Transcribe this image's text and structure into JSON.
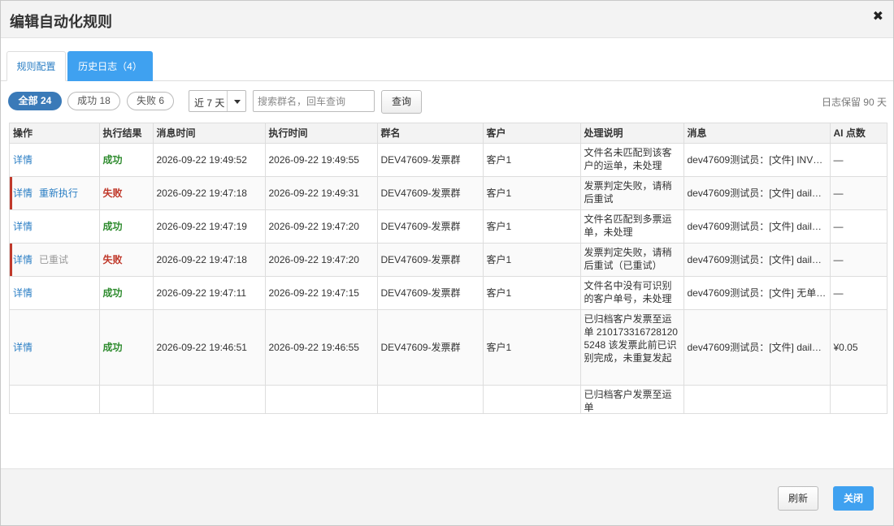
{
  "dialog": {
    "title": "编辑自动化规则",
    "close_glyph": "✖"
  },
  "tabs": [
    {
      "label": "规则配置",
      "active": false
    },
    {
      "label": "历史日志（4）",
      "active": true
    }
  ],
  "filters": {
    "all": "全部 24",
    "success": "成功 18",
    "fail": "失败 6",
    "range": "近 7 天",
    "search_placeholder": "搜索群名，回车查询",
    "query_button": "查询",
    "retention": "日志保留 90 天"
  },
  "colors": {
    "accent": "#3fa1f0",
    "link": "#2a7ec4",
    "success": "#2e8b2e",
    "fail": "#c0392b"
  },
  "table": {
    "columns": [
      "操作",
      "执行结果",
      "消息时间",
      "执行时间",
      "群名",
      "客户",
      "处理说明",
      "消息",
      "AI 点数"
    ],
    "rows": [
      {
        "actions": [
          "详情"
        ],
        "action_muted": "",
        "result": "成功",
        "status": "ok",
        "msg_time": "2026-09-22 19:49:52",
        "exec_time": "2026-09-22 19:49:55",
        "group": "DEV47609-发票群",
        "customer": "客户1",
        "note": "文件名未匹配到该客户的运单，未处理",
        "message": "dev47609测试员：[文件] INV…",
        "ai": "—"
      },
      {
        "actions": [
          "详情",
          "重新执行"
        ],
        "action_muted": "",
        "result": "失败",
        "status": "bad",
        "msg_time": "2026-09-22 19:47:18",
        "exec_time": "2026-09-22 19:49:31",
        "group": "DEV47609-发票群",
        "customer": "客户1",
        "note": "发票判定失败，请稍后重试",
        "message": "dev47609测试员：[文件] daily…",
        "ai": "—"
      },
      {
        "actions": [
          "详情"
        ],
        "action_muted": "",
        "result": "成功",
        "status": "ok",
        "msg_time": "2026-09-22 19:47:19",
        "exec_time": "2026-09-22 19:47:20",
        "group": "DEV47609-发票群",
        "customer": "客户1",
        "note": "文件名匹配到多票运单，未处理",
        "message": "dev47609测试员：[文件] daily…",
        "ai": "—"
      },
      {
        "actions": [
          "详情"
        ],
        "action_muted": "已重试",
        "result": "失败",
        "status": "bad",
        "msg_time": "2026-09-22 19:47:18",
        "exec_time": "2026-09-22 19:47:20",
        "group": "DEV47609-发票群",
        "customer": "客户1",
        "note": "发票判定失败，请稍后重试（已重试）",
        "message": "dev47609测试员：[文件] daily…",
        "ai": "—"
      },
      {
        "actions": [
          "详情"
        ],
        "action_muted": "",
        "result": "成功",
        "status": "ok",
        "msg_time": "2026-09-22 19:47:11",
        "exec_time": "2026-09-22 19:47:15",
        "group": "DEV47609-发票群",
        "customer": "客户1",
        "note": "文件名中没有可识别的客户单号，未处理",
        "message": "dev47609测试员：[文件] 无单…",
        "ai": "—"
      },
      {
        "actions": [
          "详情"
        ],
        "action_muted": "",
        "result": "成功",
        "status": "ok",
        "msg_time": "2026-09-22 19:46:51",
        "exec_time": "2026-09-22 19:46:55",
        "group": "DEV47609-发票群",
        "customer": "客户1",
        "note": "已归档客户发票至运单 2101733167281205248 该发票此前已识别完成，未重复发起",
        "message": "dev47609测试员：[文件] daily…",
        "ai": "¥0.05"
      },
      {
        "actions": [],
        "action_muted": "",
        "result": "",
        "status": "",
        "msg_time": "",
        "exec_time": "",
        "group": "",
        "customer": "",
        "note": "已归档客户发票至运单",
        "message": "",
        "ai": ""
      }
    ]
  },
  "footer": {
    "refresh": "刷新",
    "close": "关闭"
  }
}
